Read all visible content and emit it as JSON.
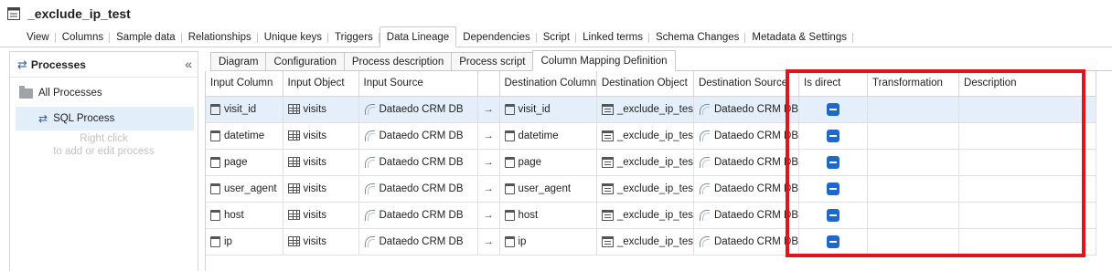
{
  "window": {
    "title": "_exclude_ip_test"
  },
  "main_tabs": [
    {
      "label": "View"
    },
    {
      "label": "Columns"
    },
    {
      "label": "Sample data"
    },
    {
      "label": "Relationships"
    },
    {
      "label": "Unique keys"
    },
    {
      "label": "Triggers"
    },
    {
      "label": "Data Lineage"
    },
    {
      "label": "Dependencies"
    },
    {
      "label": "Script"
    },
    {
      "label": "Linked terms"
    },
    {
      "label": "Schema Changes"
    },
    {
      "label": "Metadata & Settings"
    }
  ],
  "active_main_tab": "Data Lineage",
  "sidebar": {
    "header": "Processes",
    "all_label": "All Processes",
    "process_label": "SQL Process",
    "hint_line1": "Right click",
    "hint_line2": "to add or edit process"
  },
  "sub_tabs": [
    {
      "label": "Diagram"
    },
    {
      "label": "Configuration"
    },
    {
      "label": "Process description"
    },
    {
      "label": "Process script"
    },
    {
      "label": "Column Mapping Definition"
    }
  ],
  "active_sub_tab": "Column Mapping Definition",
  "grid": {
    "headers": {
      "input_column": "Input Column",
      "input_object": "Input Object",
      "input_source": "Input Source",
      "arrow": "",
      "destination_column": "Destination Column",
      "destination_object": "Destination Object",
      "destination_source": "Destination Source",
      "is_direct": "Is direct",
      "transformation": "Transformation",
      "description": "Description"
    },
    "arrow_glyph": "→",
    "rows": [
      {
        "input_column": "visit_id",
        "input_object": "visits",
        "input_source": "Dataedo CRM DB",
        "destination_column": "visit_id",
        "destination_object": "_exclude_ip_tes",
        "destination_source": "Dataedo CRM DB",
        "is_direct": "indeterminate",
        "transformation": "",
        "description": ""
      },
      {
        "input_column": "datetime",
        "input_object": "visits",
        "input_source": "Dataedo CRM DB",
        "destination_column": "datetime",
        "destination_object": "_exclude_ip_tes",
        "destination_source": "Dataedo CRM DB",
        "is_direct": "indeterminate",
        "transformation": "",
        "description": ""
      },
      {
        "input_column": "page",
        "input_object": "visits",
        "input_source": "Dataedo CRM DB",
        "destination_column": "page",
        "destination_object": "_exclude_ip_tes",
        "destination_source": "Dataedo CRM DB",
        "is_direct": "indeterminate",
        "transformation": "",
        "description": ""
      },
      {
        "input_column": "user_agent",
        "input_object": "visits",
        "input_source": "Dataedo CRM DB",
        "destination_column": "user_agent",
        "destination_object": "_exclude_ip_tes",
        "destination_source": "Dataedo CRM DB",
        "is_direct": "indeterminate",
        "transformation": "",
        "description": ""
      },
      {
        "input_column": "host",
        "input_object": "visits",
        "input_source": "Dataedo CRM DB",
        "destination_column": "host",
        "destination_object": "_exclude_ip_tes",
        "destination_source": "Dataedo CRM DB",
        "is_direct": "indeterminate",
        "transformation": "",
        "description": ""
      },
      {
        "input_column": "ip",
        "input_object": "visits",
        "input_source": "Dataedo CRM DB",
        "destination_column": "ip",
        "destination_object": "_exclude_ip_tes",
        "destination_source": "Dataedo CRM DB",
        "is_direct": "indeterminate",
        "transformation": "",
        "description": ""
      }
    ]
  },
  "colors": {
    "accent": "#1d68c8",
    "selected_row": "#e5effb",
    "highlight_box": "#e0141f"
  }
}
